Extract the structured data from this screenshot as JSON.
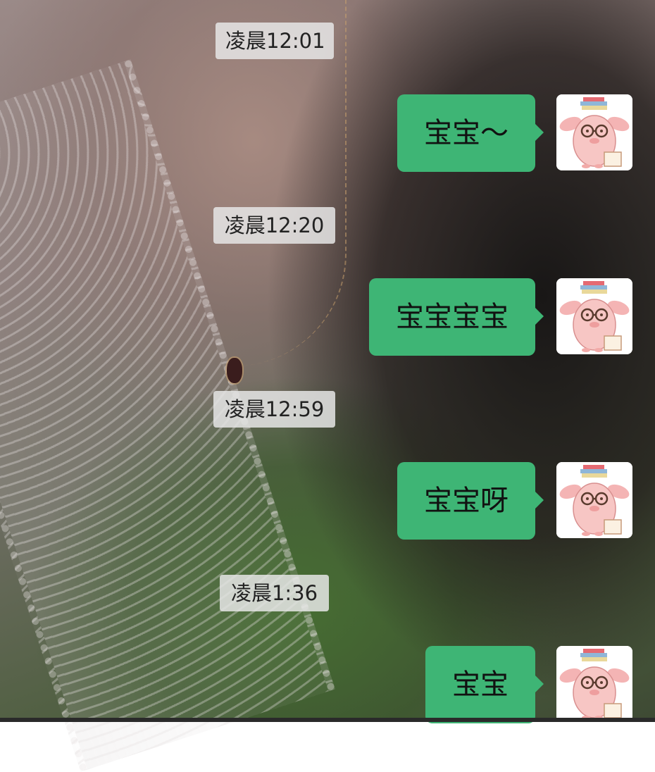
{
  "chat": {
    "messages": [
      {
        "time": "凌晨12:01",
        "text": "宝宝～"
      },
      {
        "time": "凌晨12:20",
        "text": "宝宝宝宝"
      },
      {
        "time": "凌晨12:59",
        "text": "宝宝呀"
      },
      {
        "time": "凌晨1:36",
        "text": "宝宝"
      }
    ],
    "bubble_color": "#3eb575",
    "time_chip_color": "#e6e6e6"
  },
  "avatar": {
    "icon": "pink-pig-with-glasses-and-books-sticker"
  }
}
